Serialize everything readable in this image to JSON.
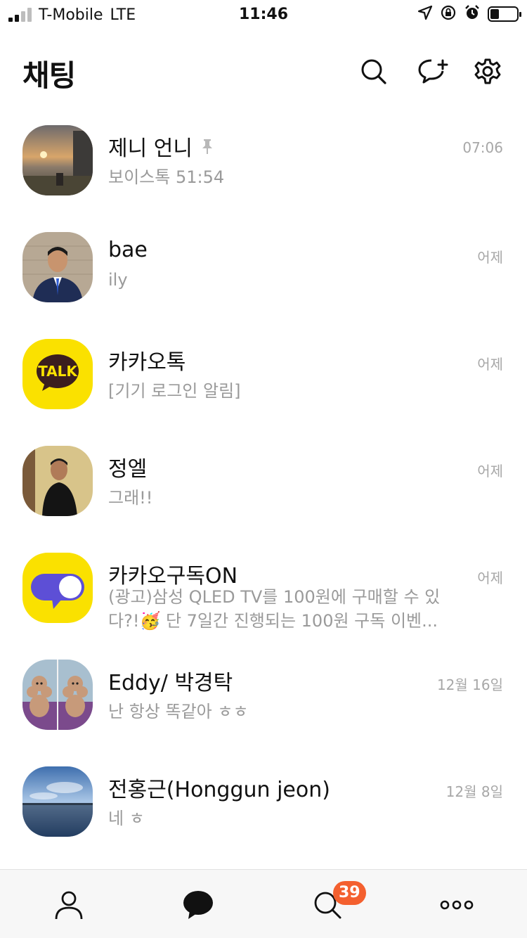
{
  "status_bar": {
    "carrier": "T-Mobile",
    "network": "LTE",
    "time": "11:46"
  },
  "header": {
    "title": "채팅",
    "icons": [
      "search-icon",
      "new-chat-icon",
      "settings-icon"
    ]
  },
  "chats": [
    {
      "name": "제니 언니",
      "pinned": true,
      "preview": "보이스톡 51:54",
      "time": "07:06",
      "avatar": "sunset-photo"
    },
    {
      "name": "bae",
      "preview": "ily",
      "time": "어제",
      "avatar": "portrait-suit-photo"
    },
    {
      "name": "카카오톡",
      "preview": "[기기 로그인 알림]",
      "time": "어제",
      "avatar": "kakaotalk-logo",
      "logo_text": "TALK"
    },
    {
      "name": "정엘",
      "preview": "그래!!",
      "time": "어제",
      "avatar": "portrait-black-shirt-photo"
    },
    {
      "name": "카카오구독ON",
      "preview": "(광고)삼성 QLED TV를 100원에 구매할 수 있다?!🥳 단 7일간 진행되는 100원 구독 이벤...",
      "time": "어제",
      "avatar": "kakao-subscribe-on-logo"
    },
    {
      "name": "Eddy/ 박경탁",
      "preview": "난 항상 똑같아 ㅎㅎ",
      "time": "12월 16일",
      "avatar": "poodle-photo"
    },
    {
      "name": "전홍근(Honggun jeon)",
      "preview": "네 ㅎ",
      "time": "12월 8일",
      "avatar": "lake-sky-photo"
    }
  ],
  "tab_bar": {
    "tabs": [
      "friends-icon",
      "chats-icon",
      "view-icon",
      "more-icon"
    ],
    "view_badge": "39"
  },
  "colors": {
    "kakao_yellow": "#fae100",
    "badge_orange": "#f4602f",
    "subscribe_purple": "#5d4fd6"
  }
}
